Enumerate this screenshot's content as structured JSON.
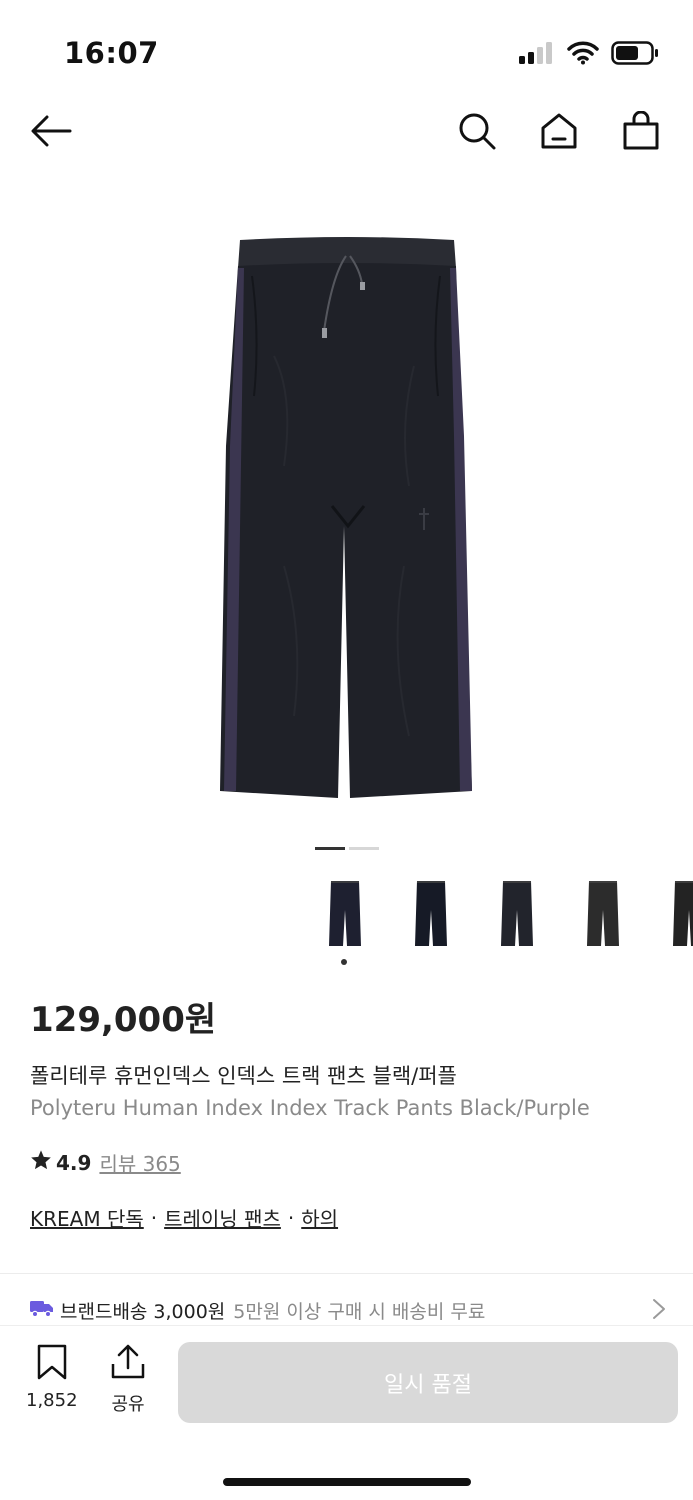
{
  "status_bar": {
    "time": "16:07",
    "signal_icon": "cellular-signal-icon",
    "wifi_icon": "wifi-icon",
    "battery_icon": "battery-icon"
  },
  "nav": {
    "back_icon": "arrow-left-icon",
    "search_icon": "search-icon",
    "home_icon": "home-icon",
    "cart_icon": "shopping-bag-icon"
  },
  "gallery": {
    "main_image": "black-purple-track-pants",
    "slide_index": 1,
    "slide_count": 2,
    "thumbnails": [
      {
        "name": "track-pants-black-purple",
        "color": "#1e2030"
      },
      {
        "name": "track-pants-black-navy",
        "color": "#161a26"
      },
      {
        "name": "track-pants-charcoal",
        "color": "#22242c"
      },
      {
        "name": "track-pants-dark-grey",
        "color": "#2c2c2c"
      },
      {
        "name": "track-pants-black",
        "color": "#232323"
      }
    ],
    "selected_thumbnail": 1
  },
  "product": {
    "price": "129,000원",
    "name_ko": "폴리테루 휴먼인덱스 인덱스 트랙 팬츠 블랙/퍼플",
    "name_en": "Polyteru Human Index Index Track Pants Black/Purple",
    "rating": "4.9",
    "review_link": "리뷰 365",
    "tags": [
      "KREAM 단독",
      "트레이닝 팬츠",
      "하의"
    ],
    "tag_separator": "·"
  },
  "shipping": {
    "icon": "truck-icon",
    "label": "브랜드배송",
    "fee": "3,000원",
    "note": "5만원 이상 구매 시 배송비 무료"
  },
  "bottom_bar": {
    "bookmark_count": "1,852",
    "share_label": "공유",
    "cta_label": "일시 품절"
  },
  "colors": {
    "accent_purple": "#6b5bdf",
    "sold_out_bg": "#d9d9d9",
    "muted_text": "#8a8a8a"
  }
}
